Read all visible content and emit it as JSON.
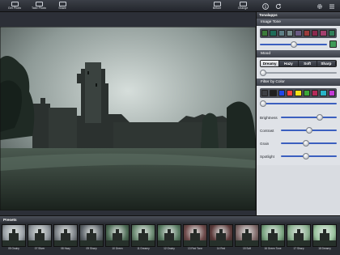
{
  "toolbar": {
    "get_photo": "Get Photo",
    "take_photo": "Take Photo",
    "share": "Share",
    "before": "Before",
    "change": "Change",
    "info_icon": "info-icon",
    "refresh_icon": "refresh-icon",
    "settings_icon": "gear-icon",
    "menu_icon": "menu-icon"
  },
  "panel": {
    "title": "Tonalapps",
    "image_tone": {
      "header": "Image Tone",
      "swatches": [
        "#3c7a3a",
        "#1e6b58",
        "#5e7f85",
        "#7a8f8f",
        "#6a5a83",
        "#9a3b3b",
        "#8a2a4e",
        "#a33f6e",
        "#2f7f59"
      ],
      "slider_level": 0.5
    },
    "mood": {
      "header": "Mood",
      "options": [
        "Dreamy",
        "Hazy",
        "Soft",
        "Sharp"
      ],
      "selected": "Dreamy",
      "slider_level": 0.02
    },
    "filter_by_color": {
      "header": "Filter by Color",
      "swatches": [
        "#3d3f45",
        "#1f1f1f",
        "#2146e8",
        "#ff4040",
        "#f5e316",
        "#3aa63a",
        "#b52a5a",
        "#26b4c8",
        "#c23ad6"
      ],
      "slider_level": 0.02
    },
    "adjustments": [
      {
        "label": "Brightness",
        "level": 0.7
      },
      {
        "label": "Contrast",
        "level": 0.5
      },
      {
        "label": "Grain",
        "level": 0.45
      },
      {
        "label": "Spotlight",
        "level": 0.45
      }
    ]
  },
  "presets": {
    "header": "Presets",
    "items": [
      {
        "label": "05 Grainy",
        "tint": "#9aa0a6"
      },
      {
        "label": "07 Silver",
        "tint": "#8d9399"
      },
      {
        "label": "08 Hazy",
        "tint": "#7c8186"
      },
      {
        "label": "09 Sharp",
        "tint": "#5f656b"
      },
      {
        "label": "10 Green",
        "tint": "#4d6b55"
      },
      {
        "label": "11 Dreamy",
        "tint": "#6b8a72"
      },
      {
        "label": "12 Grainy",
        "tint": "#587a61"
      },
      {
        "label": "13 Red Tone",
        "tint": "#6e4a4a"
      },
      {
        "label": "14 Red",
        "tint": "#5c3a3a"
      },
      {
        "label": "15 Soft",
        "tint": "#806a6a"
      },
      {
        "label": "16 Green Tone",
        "tint": "#7aa480"
      },
      {
        "label": "17 Sharp",
        "tint": "#8bb08f"
      },
      {
        "label": "18 Dreamy",
        "tint": "#9ac39e"
      }
    ]
  }
}
